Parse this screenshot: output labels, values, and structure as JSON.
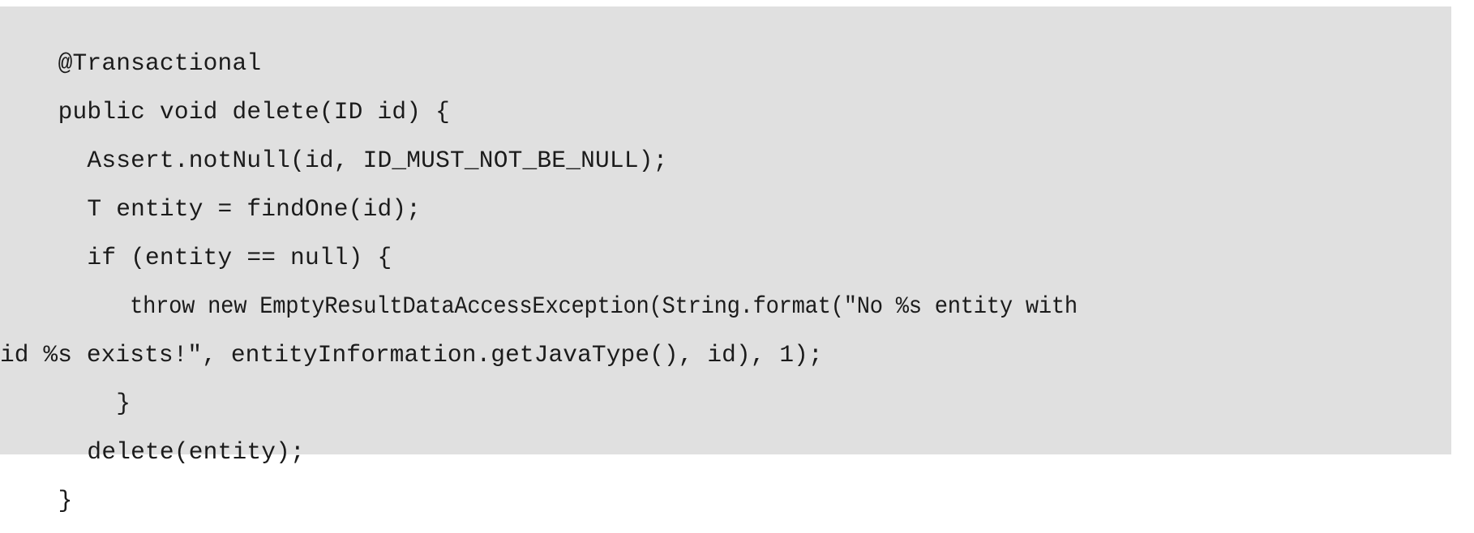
{
  "figure": {
    "kind": "source-code-listing",
    "language": "java",
    "background_color": "#e0e0e0",
    "text_color": "#1b1b1b"
  },
  "code": {
    "lines": [
      "    @Transactional",
      "    public void delete(ID id) {",
      "      Assert.notNull(id, ID_MUST_NOT_BE_NULL);",
      "      T entity = findOne(id);",
      "      if (entity == null) {",
      "          throw new EmptyResultDataAccessException(String.format(\"No %s entity with",
      "id %s exists!\", entityInformation.getJavaType(), id), 1);",
      "        }",
      "      delete(entity);",
      "    }"
    ]
  }
}
